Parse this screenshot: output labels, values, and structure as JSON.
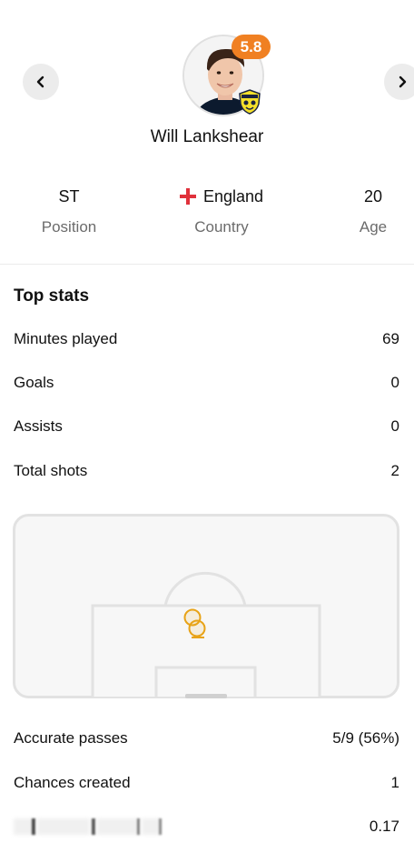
{
  "nav": {
    "prev_icon": "chevron-left-icon",
    "next_icon": "chevron-right-icon"
  },
  "player": {
    "name": "Will Lankshear",
    "rating": "5.8",
    "rating_color": "#f08022",
    "club_badge_icon": "oxford-united-badge-icon"
  },
  "info": {
    "position": {
      "value": "ST",
      "label": "Position"
    },
    "country": {
      "value": "England",
      "label": "Country",
      "flag_icon": "england-flag-icon"
    },
    "age": {
      "value": "20",
      "label": "Age"
    }
  },
  "top_stats": {
    "title": "Top stats",
    "rows": [
      {
        "label": "Minutes played",
        "value": "69"
      },
      {
        "label": "Goals",
        "value": "0"
      },
      {
        "label": "Assists",
        "value": "0"
      },
      {
        "label": "Total shots",
        "value": "2"
      }
    ]
  },
  "shot_map": {
    "marker_color": "#e8a317",
    "shots": 2
  },
  "more_stats": [
    {
      "label": "Accurate passes",
      "value": "5/9 (56%)"
    },
    {
      "label": "Chances created",
      "value": "1"
    },
    {
      "label": "",
      "value": "0.17"
    }
  ]
}
